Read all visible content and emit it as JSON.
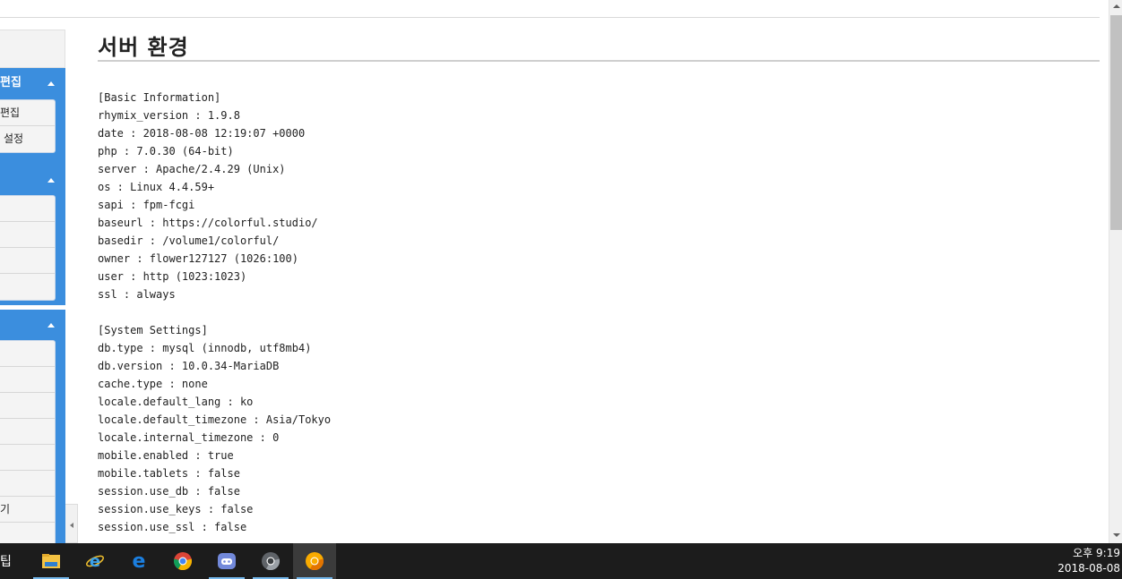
{
  "page": {
    "title": "서버 환경"
  },
  "sidebar": {
    "sections": [
      {
        "header": "편집",
        "items": [
          "편집",
          "설정"
        ]
      },
      {
        "header": "",
        "items": [
          "",
          "",
          "",
          ""
        ]
      },
      {
        "header": "",
        "items": [
          "",
          "",
          "",
          "",
          "",
          "",
          "기",
          ""
        ]
      }
    ]
  },
  "info": {
    "lines": [
      "[Basic Information]",
      "rhymix_version : 1.9.8",
      "date : 2018-08-08 12:19:07 +0000",
      "php : 7.0.30 (64-bit)",
      "server : Apache/2.4.29 (Unix)",
      "os : Linux 4.4.59+",
      "sapi : fpm-fcgi",
      "baseurl : https://colorful.studio/",
      "basedir : /volume1/colorful/",
      "owner : flower127127 (1026:100)",
      "user : http (1023:1023)",
      "ssl : always",
      "",
      "[System Settings]",
      "db.type : mysql (innodb, utf8mb4)",
      "db.version : 10.0.34-MariaDB",
      "cache.type : none",
      "locale.default_lang : ko",
      "locale.default_timezone : Asia/Tokyo",
      "locale.internal_timezone : 0",
      "mobile.enabled : true",
      "mobile.tablets : false",
      "session.use_db : false",
      "session.use_keys : false",
      "session.use_ssl : false"
    ]
  },
  "taskbar": {
    "edge_glyph": "팁",
    "apps": [
      {
        "icon": "file-explorer-icon",
        "active": true
      },
      {
        "icon": "internet-explorer-icon",
        "active": false
      },
      {
        "icon": "edge-icon",
        "active": false
      },
      {
        "icon": "chrome-icon",
        "active": false
      },
      {
        "icon": "discord-icon",
        "active": true
      },
      {
        "icon": "chrome-dev-icon",
        "active": true
      },
      {
        "icon": "chrome-canary-icon",
        "active": true,
        "focused": true
      }
    ],
    "clock_time": "오후 9:19",
    "clock_date": "2018-08-08"
  },
  "colors": {
    "sidebar_accent": "#3b8ede",
    "taskbar": "#1c1c1c",
    "active_indicator": "#76b9ed"
  }
}
